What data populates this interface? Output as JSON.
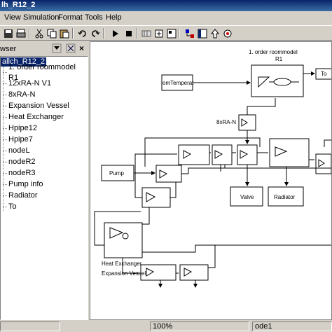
{
  "window": {
    "title": "lh_R12_2"
  },
  "menu": {
    "items": [
      "View",
      "Simulation",
      "Format",
      "Tools",
      "Help"
    ]
  },
  "toolbar": {
    "icons": [
      "print-icon",
      "cut-icon",
      "copy-icon",
      "paste-icon",
      "undo-icon",
      "redo-icon",
      "play-icon",
      "stop-icon",
      "build-icon",
      "update-icon",
      "library-icon",
      "browser-icon",
      "up-icon",
      "debug-icon"
    ]
  },
  "browser": {
    "title": "wser",
    "root": "allch_R12_2",
    "items": [
      "1. order roommodel R1",
      "12xRA-N V1",
      "8xRA-N",
      "Expansion Vessel",
      "Heat Exchanger",
      "Hpipe12",
      "Hpipe7",
      "nodeL",
      "nodeR2",
      "nodeR3",
      "Pump info",
      "Radiator",
      "To"
    ]
  },
  "diagram": {
    "roommodel_title": "1. order roommodel",
    "roommodel_sub": "R1",
    "room_temp": "omTemperat",
    "to_label": "To",
    "ra_label": "8xRA-N",
    "pump_label": "Pump",
    "valve_label": "Valve",
    "radiator_label": "Radiator",
    "heat_exchanger_label": "Heat Exchanger",
    "expansion_label": "Expansion Vessel"
  },
  "status": {
    "zoom": "100%",
    "solver": "ode1"
  }
}
